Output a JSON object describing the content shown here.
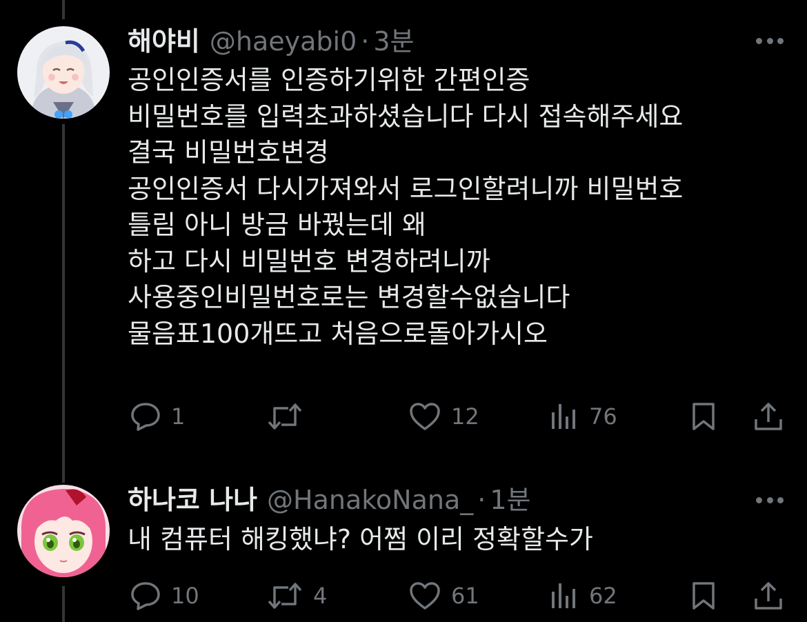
{
  "tweets": [
    {
      "display_name": "해야비",
      "handle": "@haeyabi0",
      "separator": "·",
      "time": "3분",
      "lines": [
        "공인인증서를 인증하기위한 간편인증",
        "비밀번호를 입력초과하셨습니다 다시 접속해주세요",
        "결국 비밀번호변경",
        "공인인증서 다시가져와서 로그인할려니까 비밀번호",
        "틀림 아니 방금 바꿨는데 왜",
        "하고 다시 비밀번호 변경하려니까",
        "사용중인비밀번호로는 변경할수없습니다",
        "물음표100개뜨고 처음으로돌아가시오"
      ],
      "actions": {
        "reply_count": "1",
        "retweet_count": "",
        "like_count": "12",
        "view_count": "76"
      }
    },
    {
      "display_name": "하나코 나나",
      "handle": "@HanakoNana_",
      "separator": "·",
      "time": "1분",
      "lines": [
        "내 컴퓨터 해킹했냐? 어쩜 이리 정확할수가"
      ],
      "actions": {
        "reply_count": "10",
        "retweet_count": "4",
        "like_count": "61",
        "view_count": "62"
      }
    }
  ],
  "icons": {
    "reply": "speech-bubble-icon",
    "retweet": "retweet-arrows-icon",
    "like": "heart-icon",
    "views": "bar-chart-icon",
    "bookmark": "bookmark-icon",
    "share": "share-upload-icon",
    "more": "ellipsis-icon"
  },
  "colors": {
    "background": "#000000",
    "text_primary": "#e7e9ea",
    "text_secondary": "#71767b",
    "thread_line": "#333639"
  }
}
